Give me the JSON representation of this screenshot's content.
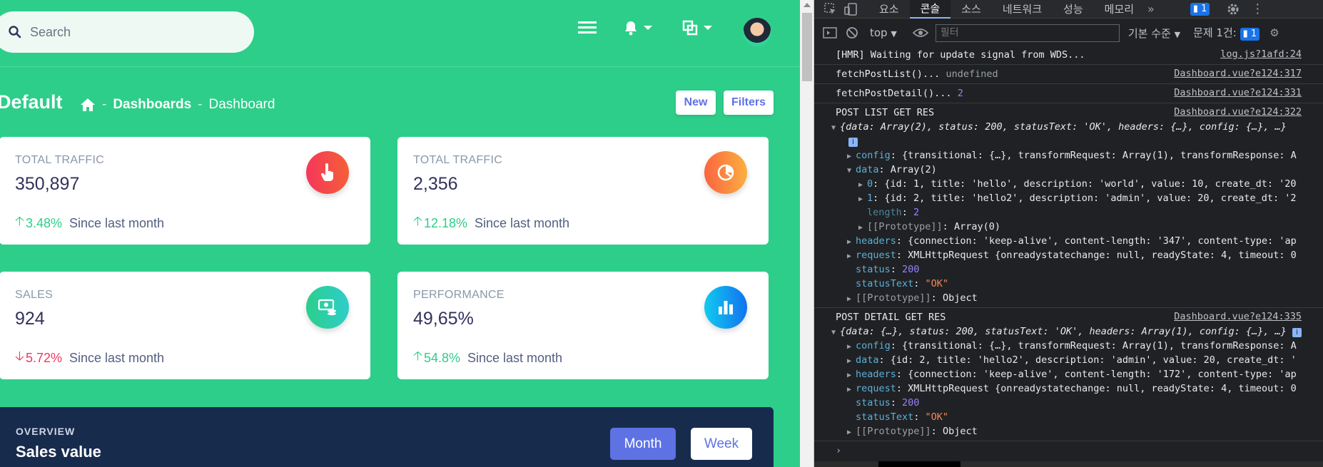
{
  "dashboard": {
    "search_placeholder": "Search",
    "page_title": "Default",
    "breadcrumb": [
      "Dashboards",
      "Dashboard"
    ],
    "new_label": "New",
    "filters_label": "Filters",
    "cards": [
      {
        "label": "TOTAL TRAFFIC",
        "value": "350,897",
        "percent": "3.48%",
        "direction": "up",
        "since": "Since last month",
        "icon": "hand-pointer-icon"
      },
      {
        "label": "TOTAL TRAFFIC",
        "value": "2,356",
        "percent": "12.18%",
        "direction": "up",
        "since": "Since last month",
        "icon": "chart-pie-icon"
      },
      {
        "label": "SALES",
        "value": "924",
        "percent": "5.72%",
        "direction": "down",
        "since": "Since last month",
        "icon": "money-coins-icon"
      },
      {
        "label": "PERFORMANCE",
        "value": "49,65%",
        "percent": "54.8%",
        "direction": "up",
        "since": "Since last month",
        "icon": "chart-bar-icon"
      }
    ],
    "overview": {
      "label": "OVERVIEW",
      "title": "Sales value",
      "month_label": "Month",
      "week_label": "Week"
    },
    "colors": {
      "background": "#2dce89",
      "primary": "#5e72e4",
      "overview_bg": "#172b4d"
    }
  },
  "devtools": {
    "tabs": [
      "요소",
      "콘솔",
      "소스",
      "네트워크",
      "성능",
      "메모리"
    ],
    "active_tab": "콘솔",
    "issues_badge": "1",
    "context": "top",
    "filter_placeholder": "필터",
    "level": "기본 수준",
    "issues_label": "문제 1건:",
    "issues_count": "1",
    "hmr": {
      "text": "[HMR] Waiting for update signal from WDS...",
      "src": "log.js?1afd:24"
    },
    "fetch_list": {
      "text": "fetchPostList()...",
      "value": "undefined",
      "src": "Dashboard.vue?e124:317"
    },
    "fetch_detail": {
      "text": "fetchPostDetail()...",
      "value": "2",
      "src": "Dashboard.vue?e124:331"
    },
    "post_list": {
      "title": "POST LIST GET RES",
      "src": "Dashboard.vue?e124:322",
      "summary": "{data: Array(2), status: 200, statusText: 'OK', headers: {…}, config: {…}, …}",
      "config": "{transitional: {…}, transformRequest: Array(1), transformResponse: A",
      "data": "Array(2)",
      "item0": "{id: 1, title: 'hello', description: 'world', value: 10, create_dt: '20",
      "item1": "{id: 2, title: 'hello2', description: 'admin', value: 20, create_dt: '2",
      "length": "2",
      "proto_array": "Array(0)",
      "headers": "{connection: 'keep-alive', content-length: '347', content-type: 'ap",
      "request": "XMLHttpRequest {onreadystatechange: null, readyState: 4, timeout: 0",
      "status": "200",
      "statusText": "\"OK\"",
      "proto": "Object"
    },
    "post_detail": {
      "title": "POST DETAIL GET RES",
      "src": "Dashboard.vue?e124:335",
      "summary": "{data: {…}, status: 200, statusText: 'OK', headers: Array(1), config: {…}, …}",
      "config": "{transitional: {…}, transformRequest: Array(1), transformResponse: A",
      "data": "{id: 2, title: 'hello2', description: 'admin', value: 20, create_dt: '",
      "headers": "{connection: 'keep-alive', content-length: '172', content-type: 'ap",
      "request": "XMLHttpRequest {onreadystatechange: null, readyState: 4, timeout: 0",
      "status": "200",
      "statusText": "\"OK\"",
      "proto": "Object"
    }
  }
}
